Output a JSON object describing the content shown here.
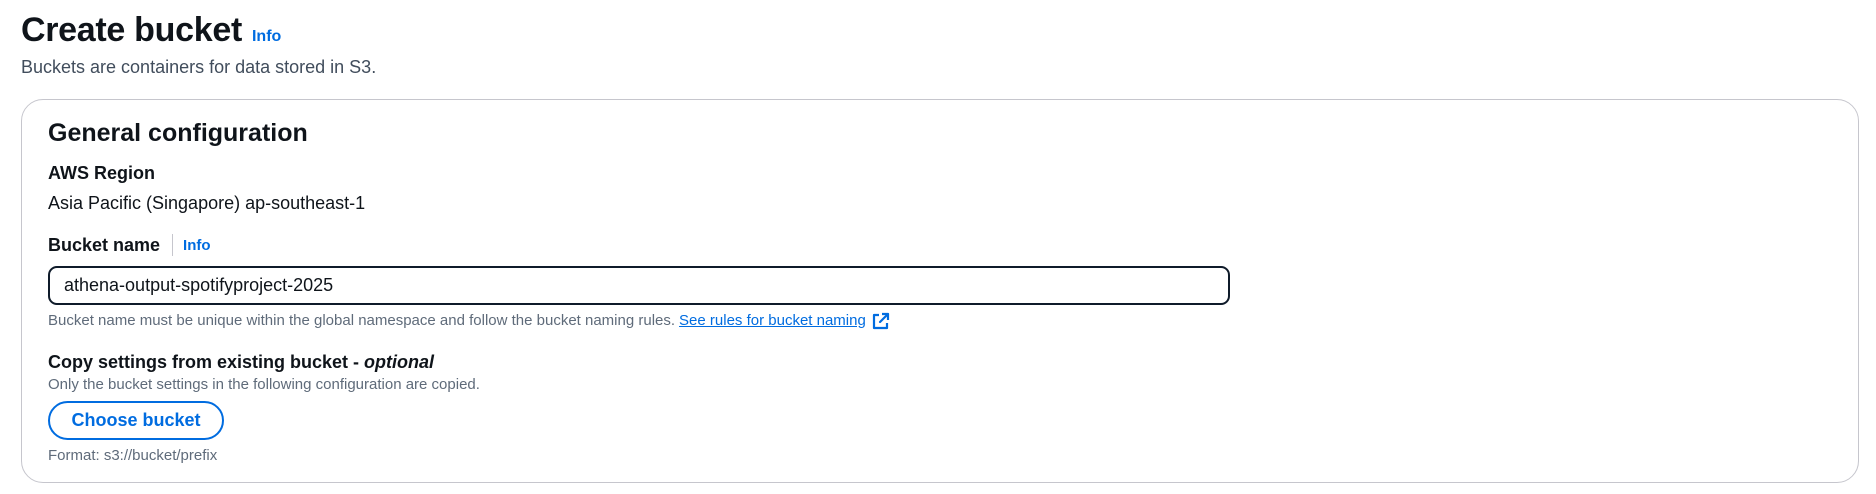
{
  "header": {
    "title": "Create bucket",
    "info_label": "Info",
    "description": "Buckets are containers for data stored in S3."
  },
  "general_configuration": {
    "title": "General configuration",
    "region": {
      "label": "AWS Region",
      "value": "Asia Pacific (Singapore) ap-southeast-1"
    },
    "bucket_name": {
      "label": "Bucket name",
      "info_label": "Info",
      "value": "athena-output-spotifyproject-2025",
      "hint": "Bucket name must be unique within the global namespace and follow the bucket naming rules.",
      "rules_link": "See rules for bucket naming",
      "rules_link_icon": "external-link-icon"
    },
    "copy_settings": {
      "label": "Copy settings from existing bucket - ",
      "optional_label": "optional",
      "description": "Only the bucket settings in the following configuration are copied.",
      "button_label": "Choose bucket",
      "format_hint": "Format: s3://bucket/prefix"
    }
  },
  "colors": {
    "link": "#006ce0",
    "text": "#0f141a",
    "secondary_text": "#5f6b7a",
    "border": "#c6c6cd"
  }
}
